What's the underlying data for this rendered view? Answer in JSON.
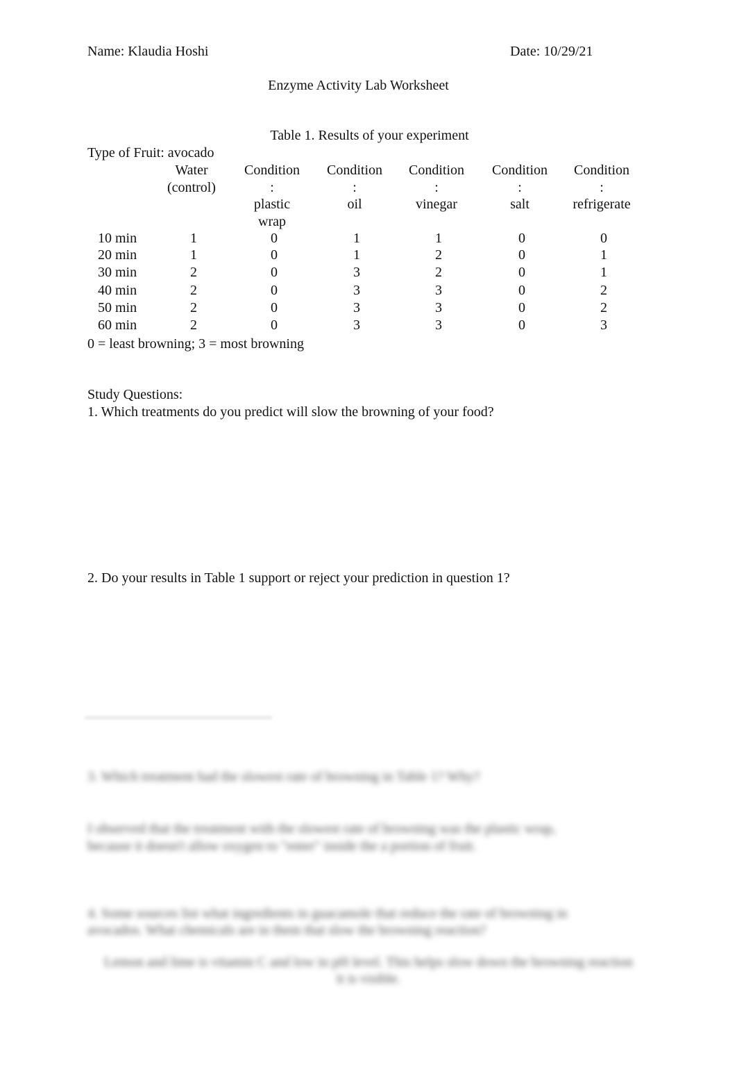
{
  "header": {
    "name": "Name: Klaudia Hoshi",
    "date": "Date: 10/29/21",
    "title": "Enzyme Activity Lab Worksheet"
  },
  "table": {
    "caption": "Table 1.  Results of your experiment",
    "fruit_label": "Type of Fruit: avocado",
    "columns": [
      {
        "lines": [
          "Water",
          "(control)"
        ]
      },
      {
        "lines": [
          "Condition",
          ":",
          "plastic",
          "wrap"
        ]
      },
      {
        "lines": [
          "Condition",
          ":",
          "oil"
        ]
      },
      {
        "lines": [
          "Condition",
          ":",
          "vinegar"
        ]
      },
      {
        "lines": [
          "Condition",
          ":",
          "salt"
        ]
      },
      {
        "lines": [
          "Condition",
          ":",
          "refrigerate"
        ]
      }
    ],
    "rows": [
      {
        "time": "10 min",
        "values": [
          "1",
          "0",
          "1",
          "1",
          "0",
          "0"
        ]
      },
      {
        "time": "20 min",
        "values": [
          "1",
          "0",
          "1",
          "2",
          "0",
          "1"
        ]
      },
      {
        "time": "30 min",
        "values": [
          "2",
          "0",
          "3",
          "2",
          "0",
          "1"
        ]
      },
      {
        "time": "40 min",
        "values": [
          "2",
          "0",
          "3",
          "3",
          "0",
          "2"
        ]
      },
      {
        "time": "50 min",
        "values": [
          "2",
          "0",
          "3",
          "3",
          "0",
          "2"
        ]
      },
      {
        "time": "60 min",
        "values": [
          "2",
          "0",
          "3",
          "3",
          "0",
          "3"
        ]
      }
    ],
    "legend": "0 = least browning; 3 = most browning"
  },
  "questions": {
    "heading": "Study Questions:",
    "q1": "1. Which treatments do you predict will slow the browning of your food?",
    "q2": "2. Do your results in Table 1 support or reject your prediction in question 1?"
  },
  "blurred": {
    "q3": "3. Which treatment had the slowest rate of browning in Table 1? Why?",
    "a3_line1": "I observed that the treatment with the slowest rate of browning was the plastic wrap,",
    "a3_line2": "because it doesn't allow oxygen to \"enter\" inside the a portion of fruit.",
    "q4_line1": "4. Some sources list what ingredients in guacamole that reduce the rate of browning in",
    "q4_line2": "avocados. What chemicals are in them that slow the browning reaction?",
    "a4_line1": "Lemon and lime is vitamin C and low in pH level. This helps slow down the browning reaction",
    "a4_line2": "it is visible."
  }
}
